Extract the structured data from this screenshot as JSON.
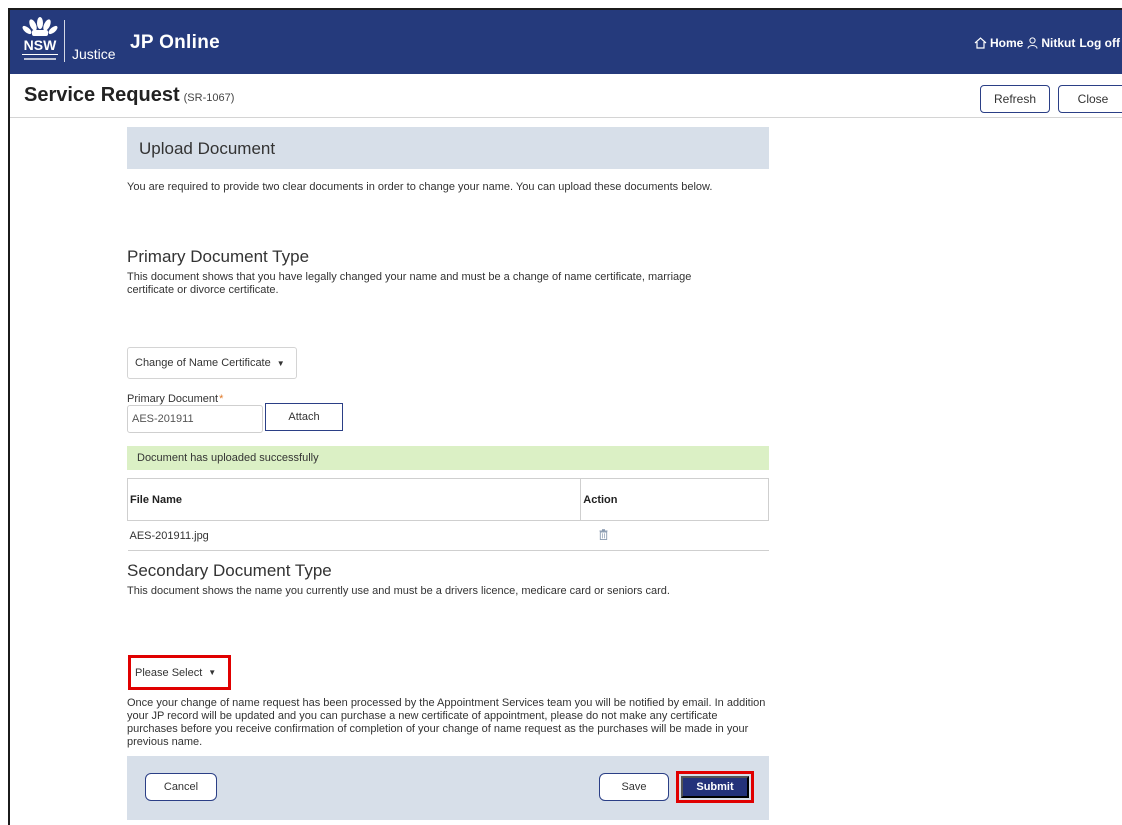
{
  "header": {
    "brand_logo_text": "NSW",
    "brand_sub": "Justice",
    "app_title": "JP Online",
    "nav": {
      "home": "Home",
      "user": "Nitkut",
      "logoff": "Log off"
    }
  },
  "page": {
    "title": "Service Request",
    "sr_number": "(SR-1067)",
    "refresh_label": "Refresh",
    "close_label": "Close"
  },
  "upload": {
    "heading": "Upload Document",
    "intro": "You are required to provide two clear documents in order to change your name. You can upload these documents below."
  },
  "primary": {
    "heading": "Primary Document Type",
    "description": "This document shows that you have legally changed your name and must be a change of name certificate, marriage certificate or divorce certificate.",
    "selected_type": "Change of Name Certificate",
    "field_label": "Primary Document",
    "field_value": "AES-201911",
    "attach_label": "Attach",
    "success_message": "Document has uploaded successfully",
    "table": {
      "col_file": "File Name",
      "col_action": "Action",
      "rows": [
        {
          "file_name": "AES-201911.jpg"
        }
      ]
    }
  },
  "secondary": {
    "heading": "Secondary Document Type",
    "description": "This document shows the name you currently use and must be a drivers licence, medicare card or seniors card.",
    "selected_type": "Please Select"
  },
  "notice": "Once your change of name request has been processed by the Appointment Services team you will be notified by email. In addition your JP record will be updated and you can purchase a new certificate of appointment, please do not make any certificate purchases before you receive confirmation of completion of your change of name request as the purchases will be made in your previous name.",
  "footer": {
    "cancel_label": "Cancel",
    "save_label": "Save",
    "submit_label": "Submit"
  },
  "colors": {
    "nav_bg": "#253a7c",
    "section_bg": "#d7dfe9",
    "success_bg": "#dbf0c5",
    "highlight": "#e00000",
    "submit_bg": "#24327a"
  }
}
